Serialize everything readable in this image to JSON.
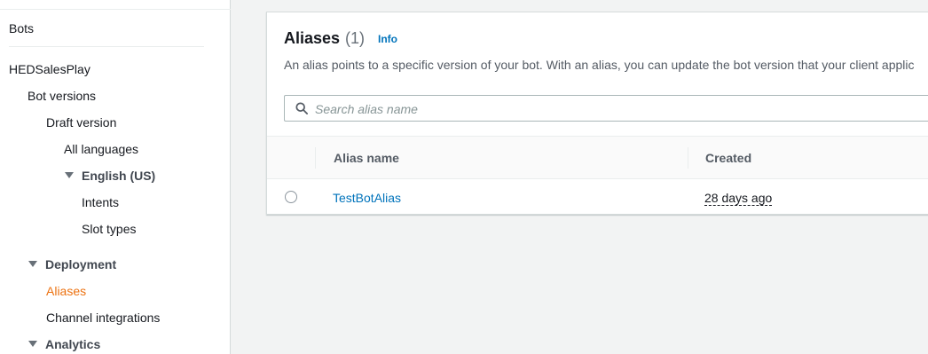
{
  "sidebar": {
    "bots": "Bots",
    "bot_name": "HEDSalesPlay",
    "bot_versions": "Bot versions",
    "draft_version": "Draft version",
    "all_languages": "All languages",
    "language": "English (US)",
    "intents": "Intents",
    "slot_types": "Slot types",
    "deployment": "Deployment",
    "aliases": "Aliases",
    "channel_integrations": "Channel integrations",
    "analytics": "Analytics"
  },
  "panel": {
    "title": "Aliases",
    "count": "(1)",
    "info": "Info",
    "description": "An alias points to a specific version of your bot. With an alias, you can update the bot version that your client applic",
    "search_placeholder": "Search alias name"
  },
  "table": {
    "headers": [
      "Alias name",
      "Created"
    ],
    "rows": [
      {
        "alias_name": "TestBotAlias",
        "created": "28 days ago"
      }
    ]
  },
  "colors": {
    "link": "#0073bb",
    "active_nav": "#ec7211"
  },
  "icons": [
    "search-icon",
    "caret-down-icon"
  ]
}
